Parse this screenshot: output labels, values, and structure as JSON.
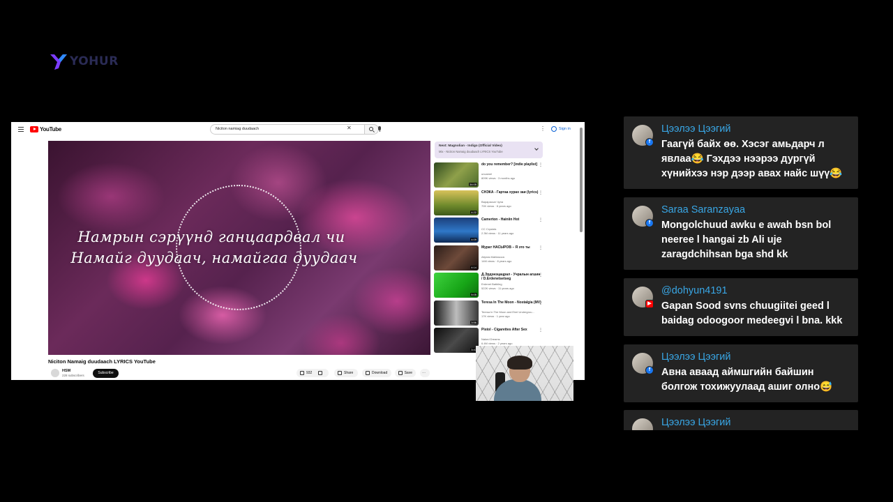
{
  "logo": {
    "text": "YOHUR",
    "colors": {
      "mark_purple": "#7b3cff",
      "mark_blue": "#2f8bff"
    }
  },
  "youtube": {
    "logo_text": "YouTube",
    "search_query": "Niciton namiag duudaach",
    "signin_label": "Sign in",
    "video": {
      "lyric_line1": "Намрын сэрүүнд ганцаардвал чи",
      "lyric_line2": "Намайг дуудаач, намайгаа дуудаач",
      "title": "Niciton Namaig duudaach LYRICS YouTube",
      "channel": "HSM",
      "subscribers": "228 subscribers",
      "subscribe_label": "Subscribe",
      "likes": "932",
      "share_label": "Share",
      "download_label": "Download",
      "save_label": "Save"
    },
    "next": {
      "label": "Next: Magnolian - Indigo (Official Video)",
      "sub": "Mix - Niciton Namaig duudaach LYRICS YouTube"
    },
    "recommendations": [
      {
        "title": "do you remember? [indie playlist]",
        "channel": "uncamel",
        "meta": "809K views · 3 months ago",
        "duration": "34:05",
        "thumb": "forest"
      },
      {
        "title": "СНЭКА - Гартаа хурах заи (lyrics)",
        "channel": "Варарасын Чуна",
        "meta": "70K views · 8 years ago",
        "duration": "4:22",
        "thumb": "field"
      },
      {
        "title": "Camerton - Hainiin Hot",
        "channel": "CC Crystals",
        "meta": "2.3M views · 11 years ago",
        "duration": "4:09",
        "thumb": "blue"
      },
      {
        "title": "Мурат НАСЫРОВ – Я это ты",
        "channel": "Aitpras Mahlasova",
        "meta": "14M views · 8 years ago",
        "duration": "4:14",
        "thumb": "portrait"
      },
      {
        "title": "Д.Эрдэнэцацрал - Учралын агшин / D.Erdenetsetseg",
        "channel": "Erdenet Batbileg",
        "meta": "522K views · 11 years ago",
        "duration": "5:05",
        "thumb": "green"
      },
      {
        "title": "Teresa In The Moon - Nostalgia (MV)",
        "channel": "Teresa In The Moon and Eirel Undergrou...",
        "meta": "17K views · 1 year ago",
        "duration": "3:56",
        "thumb": "bw"
      },
      {
        "title": "Pistol - Cigarettes After Sex",
        "channel": "Naked Dreams",
        "meta": "6.4M views · 2 years ago",
        "duration": "3:47",
        "thumb": "dark"
      }
    ]
  },
  "comments": [
    {
      "name": "Цээлээ Цээгий",
      "platform": "facebook",
      "text": "Гаагүй байх өө. Хэсэг амьдарч л явлаа😂 Гэхдээ нээрээ дургүй хүнийхээ нэр дээр авах найс шүү😂"
    },
    {
      "name": "Saraa Saranzayaa",
      "platform": "facebook",
      "text": "Mongolchuud awku e awah bsn bol neeree l hangai zb Ali uje zaragdchihsan bga shd kk"
    },
    {
      "name": "@dohyun4191",
      "platform": "youtube",
      "text": "Gapan Sood svns chuugiitei geed l baidag odoogoor medeegvi l bna. kkk"
    },
    {
      "name": "Цээлээ Цээгий",
      "platform": "facebook",
      "text": "Авна аваад аймшгийн байшин болгож тохижуулаад ашиг олно😅"
    },
    {
      "name": "Цээлээ Цээгий",
      "platform": "facebook",
      "text": ""
    }
  ]
}
